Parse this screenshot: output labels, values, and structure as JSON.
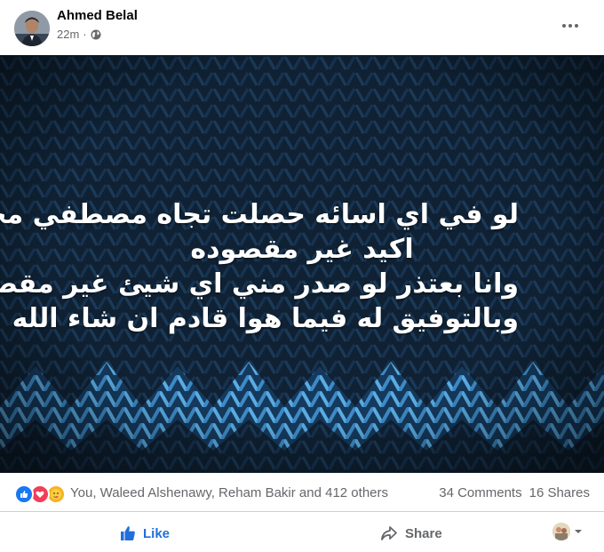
{
  "post": {
    "author": "Ahmed Belal",
    "time": "22m",
    "separator": "·",
    "privacy_icon": "globe-icon",
    "more_icon": "more-dots-icon"
  },
  "image": {
    "lines": [
      "لو في اي اسائه حصلت تجاه مصطفي محمد",
      "اكيد غير مقصوده",
      "وانا بعتذر لو صدر مني اي شيئ غير مقصود",
      "وبالتوفيق له فيما هوا قادم ان شاء الله"
    ],
    "colors": {
      "background": "#0d1b2b",
      "knit_dark": "#16324d",
      "knit_light": "#4fa6e0",
      "knit_mid": "#2b6fa8"
    }
  },
  "stats": {
    "reaction_icons": [
      "like-reaction-icon",
      "love-reaction-icon",
      "care-reaction-icon"
    ],
    "reactors": "You, Waleed Alshenawy, Reham Bakir and 412 others",
    "comments": "34 Comments",
    "shares": "16 Shares"
  },
  "actions": {
    "like_label": "Like",
    "share_label": "Share",
    "like_color": "#216fdb"
  }
}
